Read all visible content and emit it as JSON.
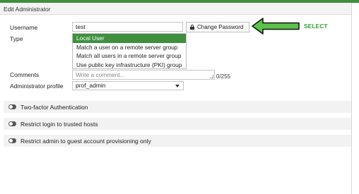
{
  "header": {
    "title": "Edit Administrator"
  },
  "form": {
    "username_label": "Username",
    "username_value": "test",
    "change_password_label": "Change Password",
    "type_label": "Type",
    "type_options": [
      "Local User",
      "Match a user on a remote server group",
      "Match all users in a remote server group",
      "Use public key infrastructure (PKI) group"
    ],
    "comments_label": "Comments",
    "comments_placeholder": "Write a comment...",
    "comments_counter": "0/255",
    "admin_profile_label": "Administrator profile",
    "admin_profile_value": "prof_admin"
  },
  "annotation": {
    "text": "SELECT",
    "color": "#3aa13a"
  },
  "sections": [
    {
      "label": "Two-factor Authentication"
    },
    {
      "label": "Restrict login to trusted hosts"
    },
    {
      "label": "Restrict admin to guest account provisioning only"
    }
  ],
  "colors": {
    "accent": "#3f8f3f",
    "section_bg": "#f2f2f2"
  }
}
